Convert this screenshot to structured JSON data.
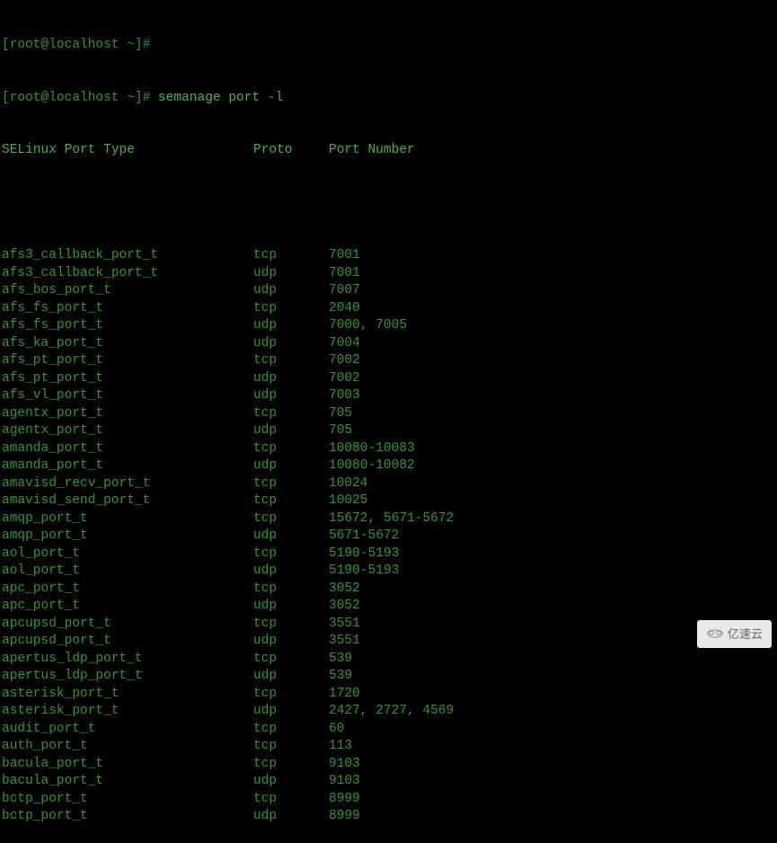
{
  "prompt": {
    "line1": "[root@localhost ~]#",
    "line2_prefix": "[root@localhost ~]# ",
    "command": "semanage port -l"
  },
  "header": {
    "type": "SELinux Port Type",
    "proto": "Proto",
    "number": "Port Number"
  },
  "rows": [
    {
      "type": "afs3_callback_port_t",
      "proto": "tcp",
      "number": "7001"
    },
    {
      "type": "afs3_callback_port_t",
      "proto": "udp",
      "number": "7001"
    },
    {
      "type": "afs_bos_port_t",
      "proto": "udp",
      "number": "7007"
    },
    {
      "type": "afs_fs_port_t",
      "proto": "tcp",
      "number": "2040"
    },
    {
      "type": "afs_fs_port_t",
      "proto": "udp",
      "number": "7000, 7005"
    },
    {
      "type": "afs_ka_port_t",
      "proto": "udp",
      "number": "7004"
    },
    {
      "type": "afs_pt_port_t",
      "proto": "tcp",
      "number": "7002"
    },
    {
      "type": "afs_pt_port_t",
      "proto": "udp",
      "number": "7002"
    },
    {
      "type": "afs_vl_port_t",
      "proto": "udp",
      "number": "7003"
    },
    {
      "type": "agentx_port_t",
      "proto": "tcp",
      "number": "705"
    },
    {
      "type": "agentx_port_t",
      "proto": "udp",
      "number": "705"
    },
    {
      "type": "amanda_port_t",
      "proto": "tcp",
      "number": "10080-10083"
    },
    {
      "type": "amanda_port_t",
      "proto": "udp",
      "number": "10080-10082"
    },
    {
      "type": "amavisd_recv_port_t",
      "proto": "tcp",
      "number": "10024"
    },
    {
      "type": "amavisd_send_port_t",
      "proto": "tcp",
      "number": "10025"
    },
    {
      "type": "amqp_port_t",
      "proto": "tcp",
      "number": "15672, 5671-5672"
    },
    {
      "type": "amqp_port_t",
      "proto": "udp",
      "number": "5671-5672"
    },
    {
      "type": "aol_port_t",
      "proto": "tcp",
      "number": "5190-5193"
    },
    {
      "type": "aol_port_t",
      "proto": "udp",
      "number": "5190-5193"
    },
    {
      "type": "apc_port_t",
      "proto": "tcp",
      "number": "3052"
    },
    {
      "type": "apc_port_t",
      "proto": "udp",
      "number": "3052"
    },
    {
      "type": "apcupsd_port_t",
      "proto": "tcp",
      "number": "3551"
    },
    {
      "type": "apcupsd_port_t",
      "proto": "udp",
      "number": "3551"
    },
    {
      "type": "apertus_ldp_port_t",
      "proto": "tcp",
      "number": "539"
    },
    {
      "type": "apertus_ldp_port_t",
      "proto": "udp",
      "number": "539"
    },
    {
      "type": "asterisk_port_t",
      "proto": "tcp",
      "number": "1720"
    },
    {
      "type": "asterisk_port_t",
      "proto": "udp",
      "number": "2427, 2727, 4569"
    },
    {
      "type": "audit_port_t",
      "proto": "tcp",
      "number": "60"
    },
    {
      "type": "auth_port_t",
      "proto": "tcp",
      "number": "113"
    },
    {
      "type": "bacula_port_t",
      "proto": "tcp",
      "number": "9103"
    },
    {
      "type": "bacula_port_t",
      "proto": "udp",
      "number": "9103"
    },
    {
      "type": "bctp_port_t",
      "proto": "tcp",
      "number": "8999"
    },
    {
      "type": "bctp_port_t",
      "proto": "udp",
      "number": "8999"
    }
  ],
  "watermark": {
    "text": "亿速云"
  }
}
